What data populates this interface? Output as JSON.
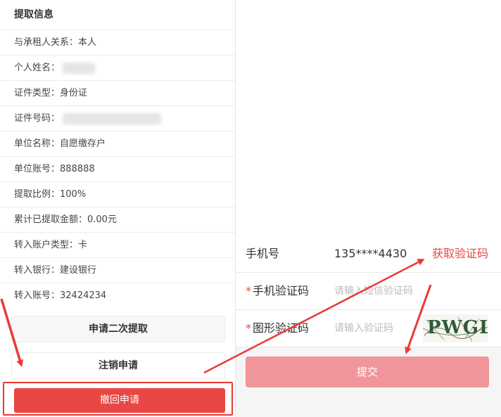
{
  "left": {
    "header": "提取信息",
    "rows": [
      {
        "label": "与承租人关系：本人"
      },
      {
        "label": "个人姓名："
      },
      {
        "label": "证件类型：身份证"
      },
      {
        "label": "证件号码："
      },
      {
        "label": "单位名称：自愿缴存户"
      },
      {
        "label": "单位账号：888888"
      },
      {
        "label": "提取比例：100%"
      },
      {
        "label": "累计已提取金额：0.00元"
      },
      {
        "label": "转入账户类型：卡"
      },
      {
        "label": "转入银行：建设银行"
      },
      {
        "label": "转入账号：32424234"
      }
    ],
    "btn_second_withdraw": "申请二次提取",
    "btn_cancel_application": "注销申请",
    "btn_revoke_application": "撤回申请"
  },
  "form": {
    "phone_label": "手机号",
    "phone_value": "135****4430",
    "get_code": "获取验证码",
    "sms_label": "手机验证码",
    "sms_placeholder": "请输入短信验证码",
    "captcha_label": "图形验证码",
    "captcha_placeholder": "请输入验证码",
    "captcha_text": "PWGL",
    "submit": "提交",
    "required_mark": "*"
  },
  "colors": {
    "accent_red": "#e84745",
    "submit_disabled": "#f0959a"
  }
}
